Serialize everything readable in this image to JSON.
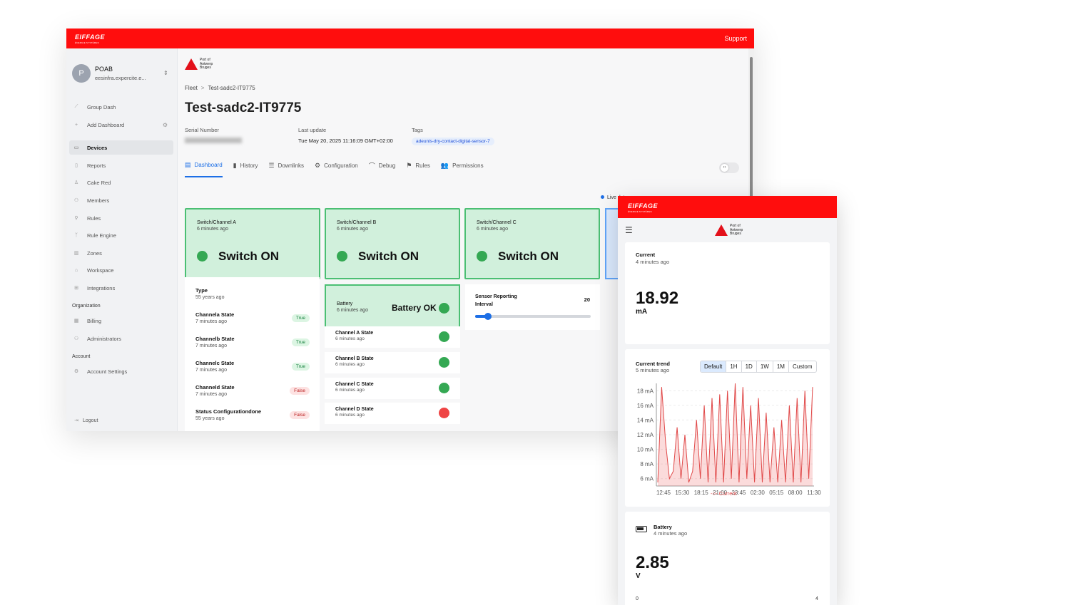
{
  "desktop": {
    "brand": "EIFFAGE",
    "brand_sub": "ÉNERGIE SYSTÈMES",
    "support": "Support",
    "user": {
      "initial": "P",
      "name": "POAB",
      "email": "eesinfra.expercite.e..."
    },
    "nav": [
      {
        "label": "Group Dash",
        "icon": "chart-line-icon"
      },
      {
        "label": "Add Dashboard",
        "icon": "plus-icon"
      },
      {
        "label": "Devices",
        "icon": "device-icon"
      },
      {
        "label": "Reports",
        "icon": "document-icon"
      },
      {
        "label": "Cake Red",
        "icon": "user-icon"
      },
      {
        "label": "Members",
        "icon": "users-icon"
      },
      {
        "label": "Rules",
        "icon": "rules-icon"
      },
      {
        "label": "Rule Engine",
        "icon": "branch-icon"
      },
      {
        "label": "Zones",
        "icon": "map-icon"
      },
      {
        "label": "Workspace",
        "icon": "home-icon"
      },
      {
        "label": "Integrations",
        "icon": "integration-icon"
      }
    ],
    "org_label": "Organization",
    "org_nav": [
      {
        "label": "Billing",
        "icon": "billing-icon"
      },
      {
        "label": "Administrators",
        "icon": "admin-icon"
      }
    ],
    "account_label": "Account",
    "account_nav": [
      {
        "label": "Account Settings",
        "icon": "gear-icon"
      }
    ],
    "logout": "Logout",
    "port_logo": {
      "l1": "Port of",
      "l2": "Antwerp",
      "l3": "Bruges"
    },
    "breadcrumb": {
      "root": "Fleet",
      "sep": ">",
      "current": "Test-sadc2-IT9775"
    },
    "title": "Test-sadc2-IT9775",
    "serial": {
      "label": "Serial Number"
    },
    "last_update": {
      "label": "Last update",
      "value": "Tue May 20, 2025 11:16:09 GMT+02:00"
    },
    "tags": {
      "label": "Tags",
      "value": "adeunis-dry-contact-digital-sensor-7"
    },
    "tabs": [
      {
        "label": "Dashboard",
        "icon": "▤"
      },
      {
        "label": "History",
        "icon": "▮"
      },
      {
        "label": "Downlinks",
        "icon": "☰"
      },
      {
        "label": "Configuration",
        "icon": "⚙"
      },
      {
        "label": "Debug",
        "icon": "⌒"
      },
      {
        "label": "Rules",
        "icon": "⚑"
      },
      {
        "label": "Permissions",
        "icon": "👥"
      }
    ],
    "toggle_glyph": "‹›",
    "live": "Live data",
    "switches": [
      {
        "title": "Switch/Channel A",
        "time": "6 minutes ago",
        "state": "Switch ON"
      },
      {
        "title": "Switch/Channel B",
        "time": "6 minutes ago",
        "state": "Switch ON"
      },
      {
        "title": "Switch/Channel C",
        "time": "6 minutes ago",
        "state": "Switch ON"
      }
    ],
    "type_card": {
      "title": "Type",
      "time": "55 years ago",
      "rows": [
        {
          "name": "Channela State",
          "time": "7 minutes ago",
          "value": "True"
        },
        {
          "name": "Channelb State",
          "time": "7 minutes ago",
          "value": "True"
        },
        {
          "name": "Channelc State",
          "time": "7 minutes ago",
          "value": "True"
        },
        {
          "name": "Channeld State",
          "time": "7 minutes ago",
          "value": "False"
        },
        {
          "name": "Status Configurationdone",
          "time": "55 years ago",
          "value": "False"
        }
      ]
    },
    "battery": {
      "title": "Battery",
      "time": "6 minutes ago",
      "status": "Battery OK"
    },
    "channels": [
      {
        "name": "Channel A State",
        "time": "6 minutes ago",
        "color": "#34a853"
      },
      {
        "name": "Channel B State",
        "time": "6 minutes ago",
        "color": "#34a853"
      },
      {
        "name": "Channel C State",
        "time": "6 minutes ago",
        "color": "#34a853"
      },
      {
        "name": "Channel D State",
        "time": "6 minutes ago",
        "color": "#ef4444"
      }
    ],
    "sensor": {
      "l1": "Sensor Reporting",
      "l2": "Interval",
      "value": "20",
      "fraction": 0.06
    }
  },
  "mobile": {
    "brand": "EIFFAGE",
    "brand_sub": "ÉNERGIE SYSTÈMES",
    "port_logo": {
      "l1": "Port of",
      "l2": "Antwerp",
      "l3": "Bruges"
    },
    "current": {
      "title": "Current",
      "time": "4 minutes ago",
      "value": "18.92",
      "unit": "mA"
    },
    "trend": {
      "title": "Current trend",
      "time": "5 minutes ago",
      "ranges": [
        "Default",
        "1H",
        "1D",
        "1W",
        "1M",
        "Custom"
      ],
      "legend": "Current"
    },
    "battery": {
      "title": "Battery",
      "time": "4 minutes ago",
      "value": "2.85",
      "unit": "V",
      "min": "0",
      "max": "4"
    }
  },
  "chart_data": {
    "type": "area",
    "title": "",
    "xlabel": "",
    "ylabel": "",
    "x_ticks": [
      "12:45",
      "15:30",
      "18:15",
      "21:00",
      "23:45",
      "02:30",
      "05:15",
      "08:00",
      "11:30"
    ],
    "y_ticks": [
      "6 mA",
      "8 mA",
      "10 mA",
      "12 mA",
      "14 mA",
      "16 mA",
      "18 mA"
    ],
    "ylim": [
      5,
      19
    ],
    "grid": true,
    "legend": "bottom",
    "series": [
      {
        "name": "Current",
        "color": "#e04848",
        "values": [
          5.5,
          18.5,
          11,
          6,
          7,
          13,
          6,
          12,
          5.5,
          7,
          14,
          6,
          16,
          5.5,
          17,
          5.5,
          17.5,
          5.5,
          18,
          6,
          19,
          5.5,
          18.5,
          6,
          16,
          5.5,
          17,
          5.5,
          15,
          5.5,
          13,
          5.5,
          14,
          5.5,
          16,
          5.5,
          17,
          5.5,
          18,
          6,
          18.5
        ]
      }
    ]
  }
}
